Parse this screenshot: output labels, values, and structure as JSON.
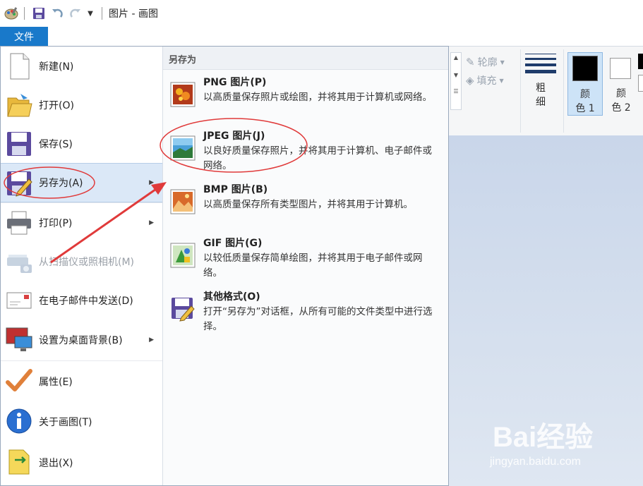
{
  "titlebar": {
    "title": "图片 - 画图"
  },
  "file_tab": {
    "label": "文件"
  },
  "left_menu": {
    "items": [
      {
        "label": "新建(N)",
        "icon": "new-file-icon",
        "disabled": false,
        "arrow": false
      },
      {
        "label": "打开(O)",
        "icon": "open-folder-icon",
        "disabled": false,
        "arrow": false
      },
      {
        "label": "保存(S)",
        "icon": "save-icon",
        "disabled": false,
        "arrow": false
      },
      {
        "label": "另存为(A)",
        "icon": "save-as-icon",
        "disabled": false,
        "arrow": true,
        "selected": true
      },
      {
        "label": "打印(P)",
        "icon": "printer-icon",
        "disabled": false,
        "arrow": true
      },
      {
        "label": "从扫描仪或照相机(M)",
        "icon": "scanner-icon",
        "disabled": true,
        "arrow": false
      },
      {
        "label": "在电子邮件中发送(D)",
        "icon": "email-icon",
        "disabled": false,
        "arrow": false
      },
      {
        "label": "设置为桌面背景(B)",
        "icon": "desktop-icon",
        "disabled": false,
        "arrow": true
      },
      {
        "label": "属性(E)",
        "icon": "checkmark-icon",
        "disabled": false,
        "arrow": false
      },
      {
        "label": "关于画图(T)",
        "icon": "info-icon",
        "disabled": false,
        "arrow": false
      },
      {
        "label": "退出(X)",
        "icon": "exit-icon",
        "disabled": false,
        "arrow": false
      }
    ]
  },
  "submenu": {
    "header": "另存为",
    "options": [
      {
        "title": "PNG 图片(P)",
        "desc": "以高质量保存照片或绘图，并将其用于计算机或网络。",
        "icon": "png-image-icon"
      },
      {
        "title": "JPEG 图片(J)",
        "desc": "以良好质量保存照片，并将其用于计算机、电子邮件或网络。",
        "icon": "jpeg-image-icon"
      },
      {
        "title": "BMP 图片(B)",
        "desc": "以高质量保存所有类型图片，并将其用于计算机。",
        "icon": "bmp-image-icon"
      },
      {
        "title": "GIF 图片(G)",
        "desc": "以较低质量保存简单绘图，并将其用于电子邮件或网络。",
        "icon": "gif-image-icon"
      },
      {
        "title": "其他格式(O)",
        "desc": "打开“另存为”对话框，从所有可能的文件类型中进行选择。",
        "icon": "other-formats-icon"
      }
    ]
  },
  "ribbon": {
    "outline_label": "轮廓",
    "fill_label": "填充",
    "size_label_1": "粗",
    "size_label_2": "细",
    "color1_label_1": "颜",
    "color1_label_2": "色 1",
    "color2_label_1": "颜",
    "color2_label_2": "色 2",
    "color1_value": "#000000",
    "color2_value": "#ffffff"
  },
  "watermark": {
    "brand": "Bai经验",
    "url": "jingyan.baidu.com"
  },
  "colors": {
    "file_tab": "#1979ca",
    "annotation": "#e03a3a",
    "selected_bg": "#dbe8f7"
  }
}
